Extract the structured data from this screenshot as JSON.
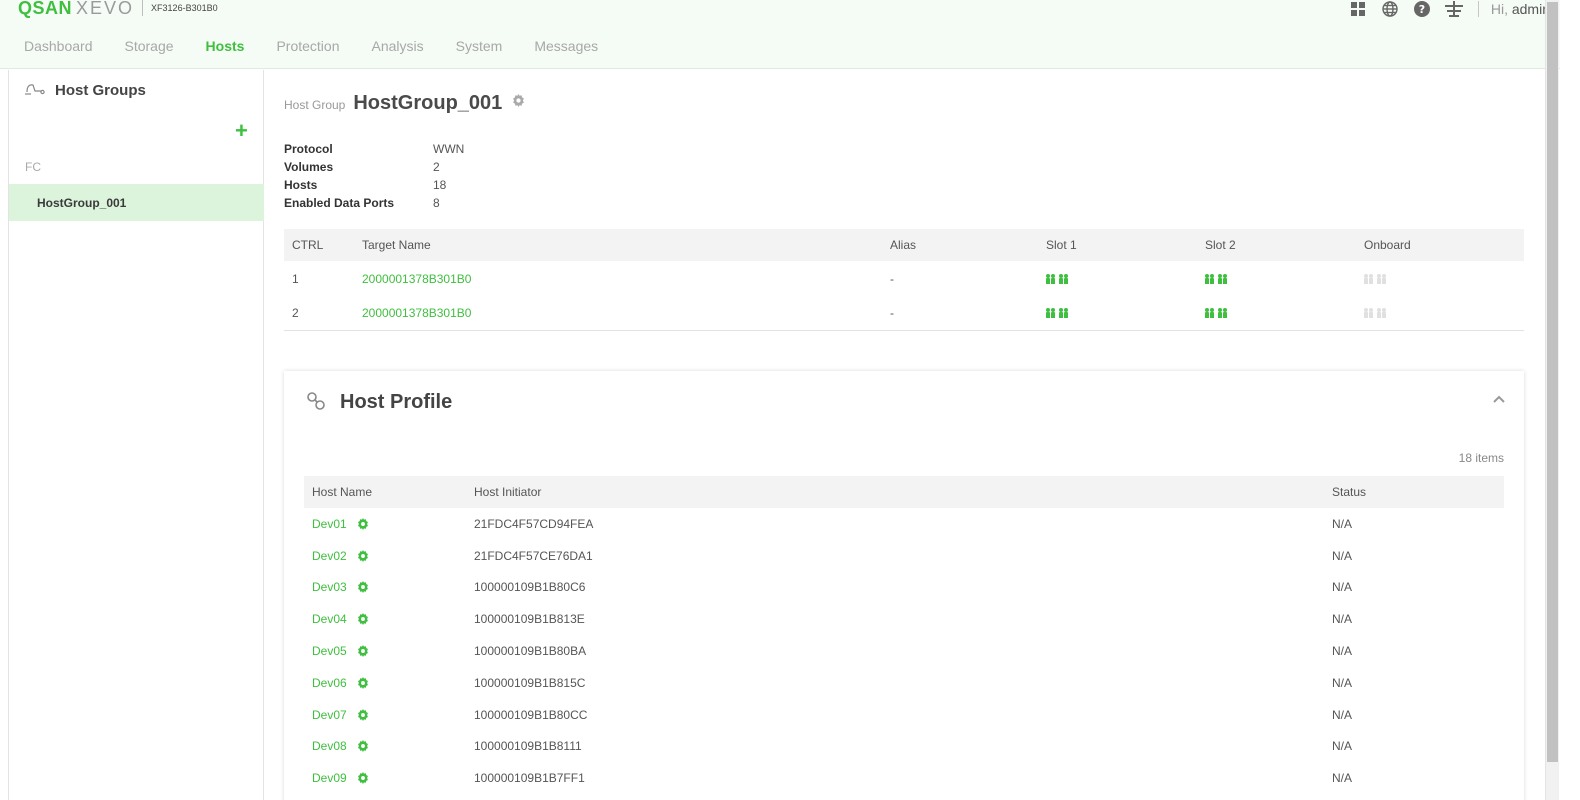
{
  "header": {
    "brand_primary": "QSAN",
    "brand_secondary": "XEVO",
    "model": "XF3126-B301B0",
    "greeting": "Hi,",
    "user": "admin",
    "icons": [
      "grid-icon",
      "globe-icon",
      "help-icon",
      "network-icon"
    ]
  },
  "nav": {
    "items": [
      {
        "label": "Dashboard"
      },
      {
        "label": "Storage"
      },
      {
        "label": "Hosts",
        "active": true
      },
      {
        "label": "Protection"
      },
      {
        "label": "Analysis"
      },
      {
        "label": "System"
      },
      {
        "label": "Messages"
      }
    ]
  },
  "sidebar": {
    "title": "Host Groups",
    "add_label": "+",
    "category": "FC",
    "items": [
      {
        "label": "HostGroup_001",
        "selected": true
      }
    ]
  },
  "page": {
    "pre_label": "Host Group",
    "title": "HostGroup_001",
    "properties": [
      {
        "key": "Protocol",
        "value": "WWN"
      },
      {
        "key": "Volumes",
        "value": "2"
      },
      {
        "key": "Hosts",
        "value": "18"
      },
      {
        "key": "Enabled Data Ports",
        "value": "8"
      }
    ]
  },
  "targets": {
    "columns": [
      "CTRL",
      "Target Name",
      "Alias",
      "Slot 1",
      "Slot 2",
      "Onboard"
    ],
    "rows": [
      {
        "ctrl": "1",
        "target": "2000001378B301B0",
        "alias": "-"
      },
      {
        "ctrl": "2",
        "target": "2000001378B301B0",
        "alias": "-"
      }
    ]
  },
  "host_profile": {
    "title": "Host Profile",
    "count": "18 items",
    "columns": [
      "Host Name",
      "Host Initiator",
      "Status"
    ],
    "rows": [
      {
        "name": "Dev01",
        "initiator": "21FDC4F57CD94FEA",
        "status": "N/A"
      },
      {
        "name": "Dev02",
        "initiator": "21FDC4F57CE76DA1",
        "status": "N/A"
      },
      {
        "name": "Dev03",
        "initiator": "100000109B1B80C6",
        "status": "N/A"
      },
      {
        "name": "Dev04",
        "initiator": "100000109B1B813E",
        "status": "N/A"
      },
      {
        "name": "Dev05",
        "initiator": "100000109B1B80BA",
        "status": "N/A"
      },
      {
        "name": "Dev06",
        "initiator": "100000109B1B815C",
        "status": "N/A"
      },
      {
        "name": "Dev07",
        "initiator": "100000109B1B80CC",
        "status": "N/A"
      },
      {
        "name": "Dev08",
        "initiator": "100000109B1B8111",
        "status": "N/A"
      },
      {
        "name": "Dev09",
        "initiator": "100000109B1B7FF1",
        "status": "N/A"
      }
    ]
  },
  "colors": {
    "accent": "#3fbf3f",
    "selected_bg": "#dcf3dc",
    "header_bg": "#f5fbf5",
    "port_inactive": "#e0e0e0"
  }
}
